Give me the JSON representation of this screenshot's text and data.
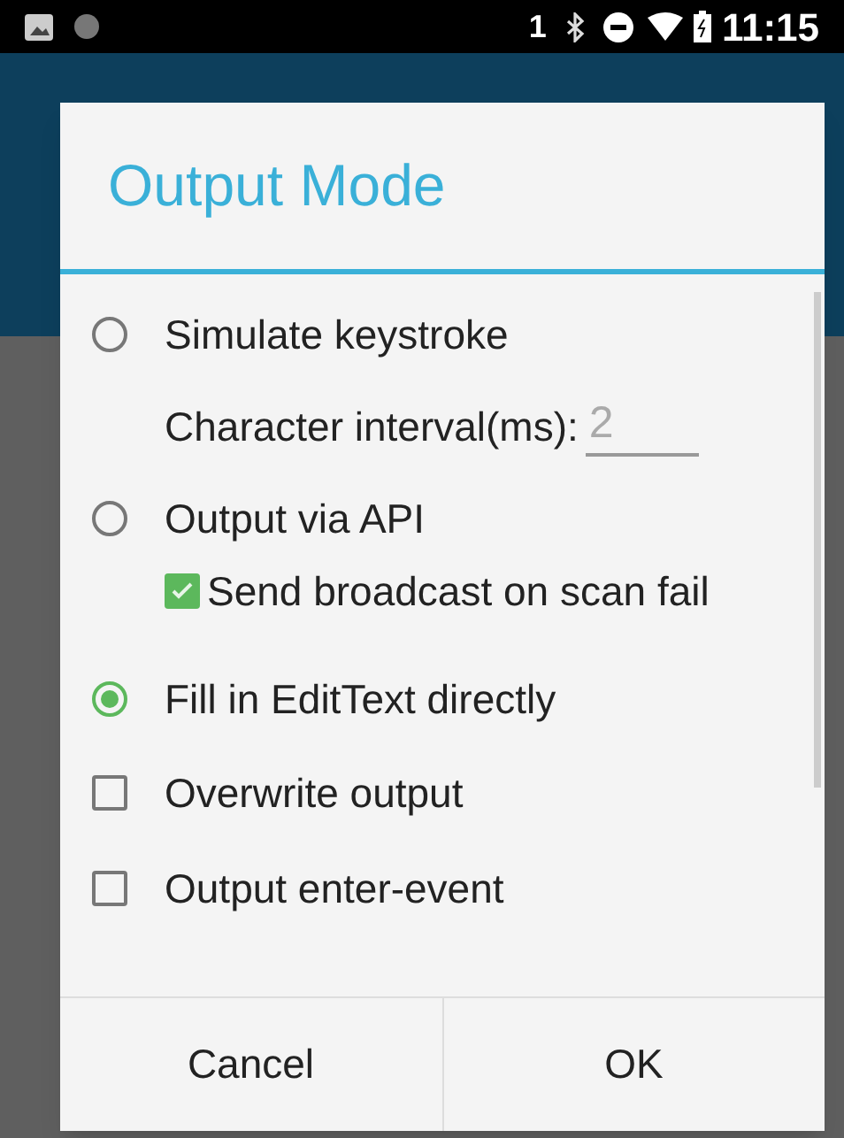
{
  "status_bar": {
    "sim_slot": "1",
    "time": "11:15"
  },
  "dialog": {
    "title": "Output Mode",
    "options": [
      {
        "kind": "radio",
        "label": "Simulate keystroke",
        "selected": false,
        "children": [
          {
            "kind": "field",
            "label": "Character interval(ms):",
            "value": "2"
          }
        ]
      },
      {
        "kind": "radio",
        "label": "Output via API",
        "selected": false,
        "children": [
          {
            "kind": "checkbox",
            "label": "Send broadcast on scan fail",
            "checked": true
          }
        ]
      },
      {
        "kind": "radio",
        "label": "Fill in EditText directly",
        "selected": true
      },
      {
        "kind": "checkbox",
        "label": "Overwrite output",
        "checked": false
      },
      {
        "kind": "checkbox",
        "label": "Output enter-event",
        "checked": false
      }
    ],
    "buttons": [
      "Cancel",
      "OK"
    ]
  }
}
